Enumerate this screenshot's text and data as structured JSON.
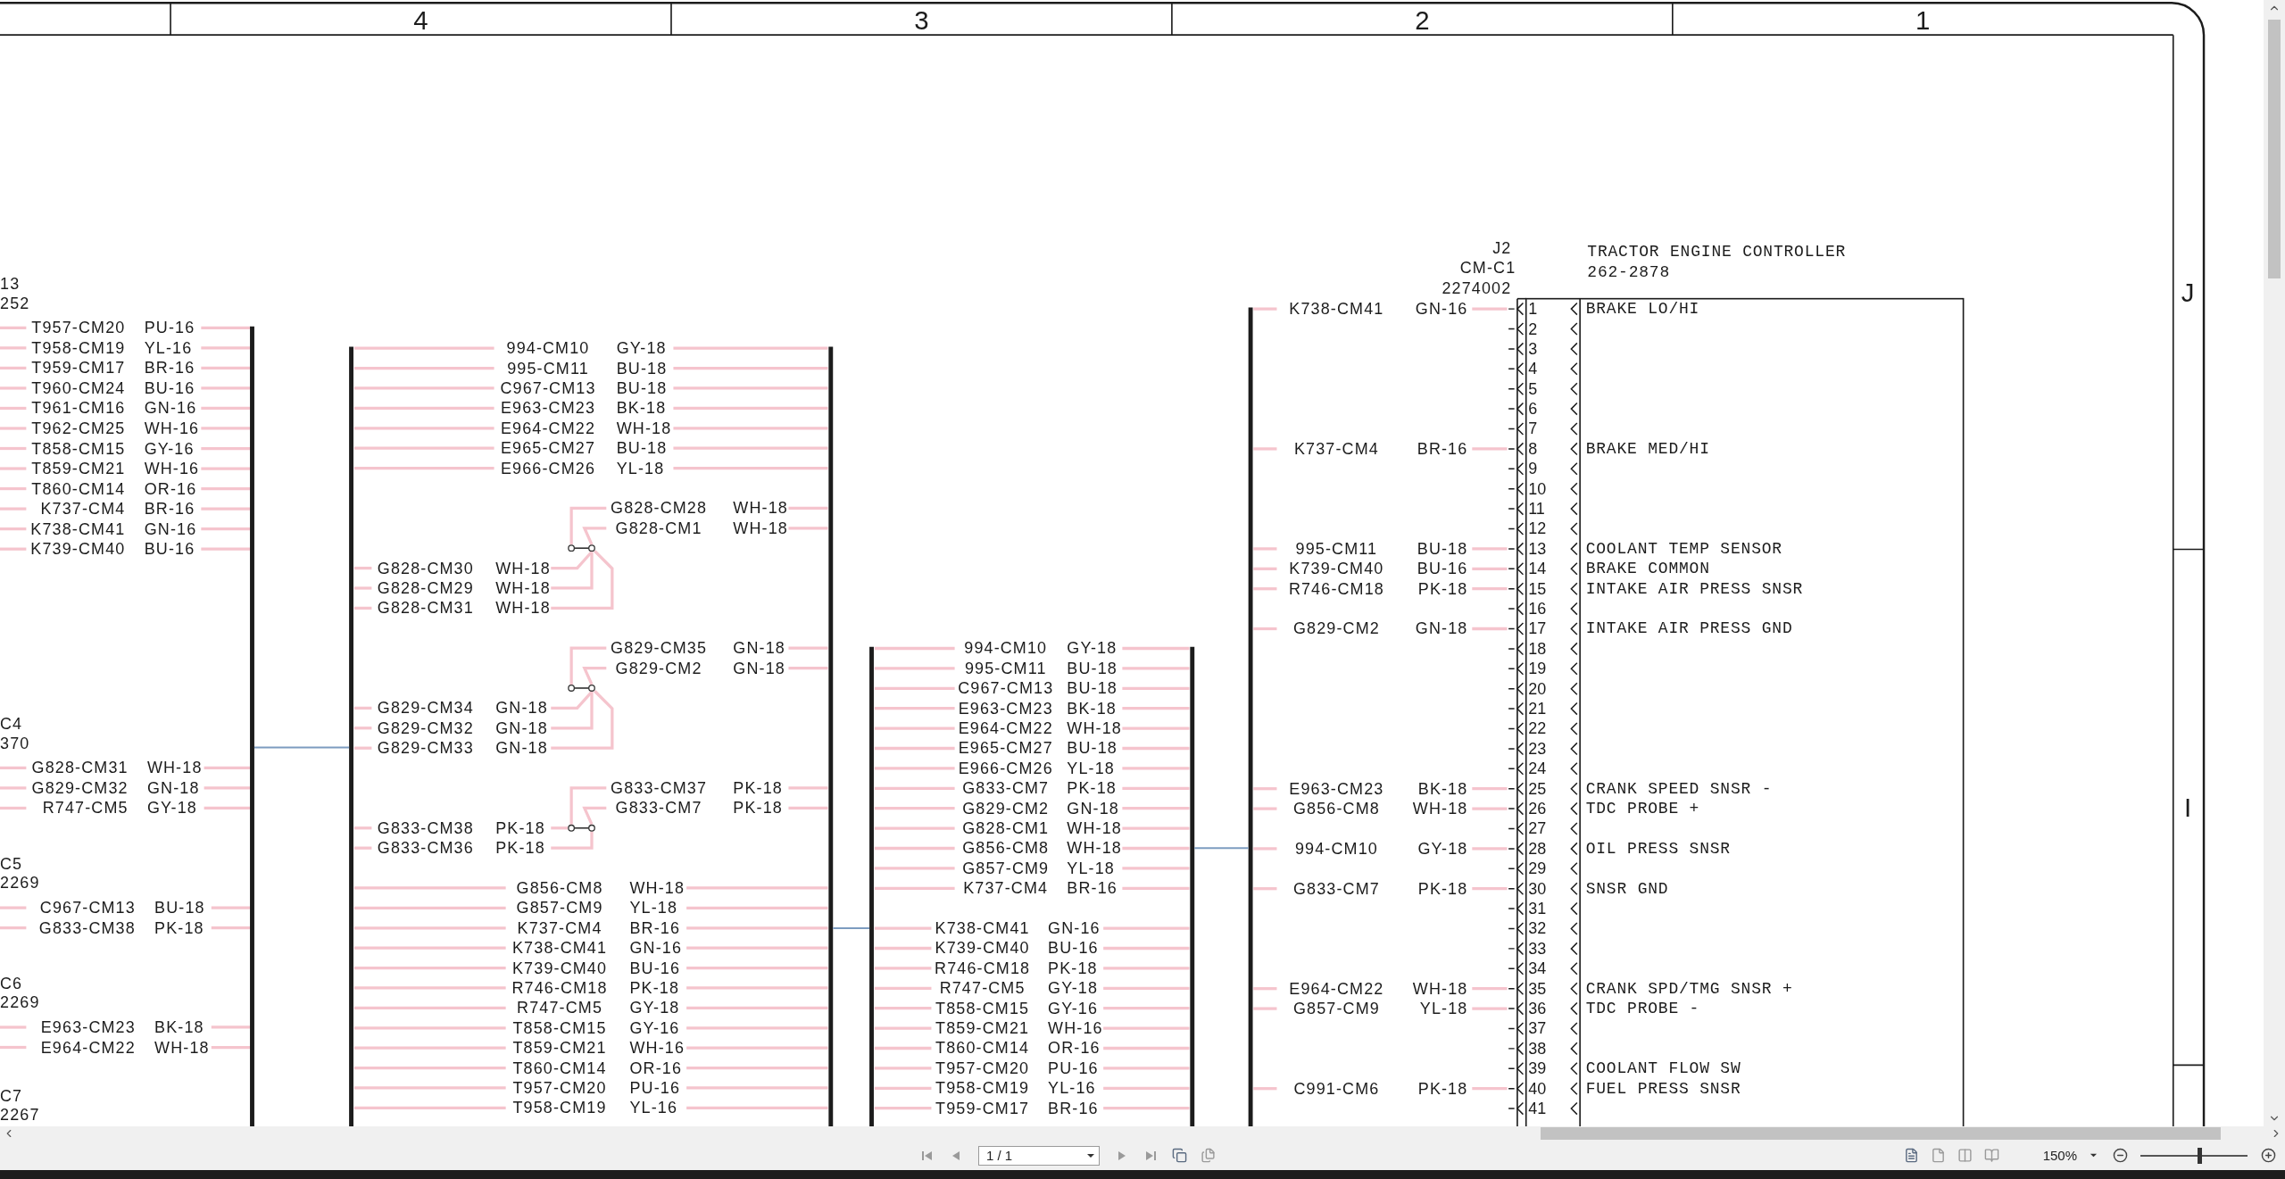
{
  "frame": {
    "columns": [
      "4",
      "3",
      "2",
      "1"
    ],
    "rows": [
      "J",
      "I"
    ]
  },
  "left_connectors": [
    {
      "name": "13",
      "part": "252",
      "wires": [
        {
          "circuit": "T957-CM20",
          "gauge": "PU-16"
        },
        {
          "circuit": "T958-CM19",
          "gauge": "YL-16"
        },
        {
          "circuit": "T959-CM17",
          "gauge": "BR-16"
        },
        {
          "circuit": "T960-CM24",
          "gauge": "BU-16"
        },
        {
          "circuit": "T961-CM16",
          "gauge": "GN-16"
        },
        {
          "circuit": "T962-CM25",
          "gauge": "WH-16"
        },
        {
          "circuit": "T858-CM15",
          "gauge": "GY-16"
        },
        {
          "circuit": "T859-CM21",
          "gauge": "WH-16"
        },
        {
          "circuit": "T860-CM14",
          "gauge": "OR-16"
        },
        {
          "circuit": "K737-CM4",
          "gauge": "BR-16"
        },
        {
          "circuit": "K738-CM41",
          "gauge": "GN-16"
        },
        {
          "circuit": "K739-CM40",
          "gauge": "BU-16"
        }
      ]
    },
    {
      "name": "C4",
      "part": "370",
      "wires": [
        {
          "circuit": "G828-CM31",
          "gauge": "WH-18"
        },
        {
          "circuit": "G829-CM32",
          "gauge": "GN-18"
        },
        {
          "circuit": "R747-CM5",
          "gauge": "GY-18"
        }
      ]
    },
    {
      "name": "C5",
      "part": "2269",
      "wires": [
        {
          "circuit": "C967-CM13",
          "gauge": "BU-18"
        },
        {
          "circuit": "G833-CM38",
          "gauge": "PK-18"
        }
      ]
    },
    {
      "name": "C6",
      "part": "2269",
      "wires": [
        {
          "circuit": "E963-CM23",
          "gauge": "BK-18"
        },
        {
          "circuit": "E964-CM22",
          "gauge": "WH-18"
        }
      ]
    },
    {
      "name": "C7",
      "part": "2267"
    }
  ],
  "splice_bus": {
    "sections": [
      {
        "kind": "through",
        "wires": [
          {
            "circuit": "994-CM10",
            "gauge": "GY-18"
          },
          {
            "circuit": "995-CM11",
            "gauge": "BU-18"
          },
          {
            "circuit": "C967-CM13",
            "gauge": "BU-18"
          },
          {
            "circuit": "E963-CM23",
            "gauge": "BK-18"
          },
          {
            "circuit": "E964-CM22",
            "gauge": "WH-18"
          },
          {
            "circuit": "E965-CM27",
            "gauge": "BU-18"
          },
          {
            "circuit": "E966-CM26",
            "gauge": "YL-18"
          }
        ]
      },
      {
        "kind": "splice",
        "right_wires": [
          {
            "circuit": "G828-CM28",
            "gauge": "WH-18"
          },
          {
            "circuit": "G828-CM1",
            "gauge": "WH-18"
          }
        ],
        "left_wires": [
          {
            "circuit": "G828-CM30",
            "gauge": "WH-18"
          },
          {
            "circuit": "G828-CM29",
            "gauge": "WH-18"
          },
          {
            "circuit": "G828-CM31",
            "gauge": "WH-18"
          }
        ]
      },
      {
        "kind": "splice",
        "right_wires": [
          {
            "circuit": "G829-CM35",
            "gauge": "GN-18"
          },
          {
            "circuit": "G829-CM2",
            "gauge": "GN-18"
          }
        ],
        "left_wires": [
          {
            "circuit": "G829-CM34",
            "gauge": "GN-18"
          },
          {
            "circuit": "G829-CM32",
            "gauge": "GN-18"
          },
          {
            "circuit": "G829-CM33",
            "gauge": "GN-18"
          }
        ]
      },
      {
        "kind": "splice",
        "right_wires": [
          {
            "circuit": "G833-CM37",
            "gauge": "PK-18"
          },
          {
            "circuit": "G833-CM7",
            "gauge": "PK-18"
          }
        ],
        "left_wires": [
          {
            "circuit": "G833-CM38",
            "gauge": "PK-18"
          },
          {
            "circuit": "G833-CM36",
            "gauge": "PK-18"
          }
        ]
      },
      {
        "kind": "through",
        "wires": [
          {
            "circuit": "G856-CM8",
            "gauge": "WH-18"
          },
          {
            "circuit": "G857-CM9",
            "gauge": "YL-18"
          },
          {
            "circuit": "K737-CM4",
            "gauge": "BR-16"
          },
          {
            "circuit": "K738-CM41",
            "gauge": "GN-16"
          },
          {
            "circuit": "K739-CM40",
            "gauge": "BU-16"
          },
          {
            "circuit": "R746-CM18",
            "gauge": "PK-18"
          },
          {
            "circuit": "R747-CM5",
            "gauge": "GY-18"
          },
          {
            "circuit": "T858-CM15",
            "gauge": "GY-16"
          },
          {
            "circuit": "T859-CM21",
            "gauge": "WH-16"
          },
          {
            "circuit": "T860-CM14",
            "gauge": "OR-16"
          },
          {
            "circuit": "T957-CM20",
            "gauge": "PU-16"
          },
          {
            "circuit": "T958-CM19",
            "gauge": "YL-16"
          }
        ]
      }
    ]
  },
  "harness_bus": {
    "sections": [
      {
        "kind": "through",
        "wires": [
          {
            "circuit": "994-CM10",
            "gauge": "GY-18"
          },
          {
            "circuit": "995-CM11",
            "gauge": "BU-18"
          },
          {
            "circuit": "C967-CM13",
            "gauge": "BU-18"
          },
          {
            "circuit": "E963-CM23",
            "gauge": "BK-18"
          },
          {
            "circuit": "E964-CM22",
            "gauge": "WH-18"
          },
          {
            "circuit": "E965-CM27",
            "gauge": "BU-18"
          },
          {
            "circuit": "E966-CM26",
            "gauge": "YL-18"
          },
          {
            "circuit": "G833-CM7",
            "gauge": "PK-18"
          },
          {
            "circuit": "G829-CM2",
            "gauge": "GN-18"
          },
          {
            "circuit": "G828-CM1",
            "gauge": "WH-18"
          },
          {
            "circuit": "G856-CM8",
            "gauge": "WH-18"
          },
          {
            "circuit": "G857-CM9",
            "gauge": "YL-18"
          },
          {
            "circuit": "K737-CM4",
            "gauge": "BR-16"
          }
        ]
      },
      {
        "kind": "through",
        "wires": [
          {
            "circuit": "K738-CM41",
            "gauge": "GN-16"
          },
          {
            "circuit": "K739-CM40",
            "gauge": "BU-16"
          },
          {
            "circuit": "R746-CM18",
            "gauge": "PK-18"
          },
          {
            "circuit": "R747-CM5",
            "gauge": "GY-18"
          },
          {
            "circuit": "T858-CM15",
            "gauge": "GY-16"
          },
          {
            "circuit": "T859-CM21",
            "gauge": "WH-16"
          },
          {
            "circuit": "T860-CM14",
            "gauge": "OR-16"
          },
          {
            "circuit": "T957-CM20",
            "gauge": "PU-16"
          },
          {
            "circuit": "T958-CM19",
            "gauge": "YL-16"
          },
          {
            "circuit": "T959-CM17",
            "gauge": "BR-16"
          }
        ]
      }
    ]
  },
  "controller": {
    "title": "TRACTOR ENGINE CONTROLLER",
    "part": "262-2878",
    "connector": {
      "name": "J2",
      "code": "CM-C1",
      "part": "2274002"
    },
    "pins": [
      {
        "number": "1",
        "function": "BRAKE LO/HI",
        "wire": {
          "circuit": "K738-CM41",
          "gauge": "GN-16"
        }
      },
      {
        "number": "2"
      },
      {
        "number": "3"
      },
      {
        "number": "4"
      },
      {
        "number": "5"
      },
      {
        "number": "6"
      },
      {
        "number": "7"
      },
      {
        "number": "8",
        "function": "BRAKE MED/HI",
        "wire": {
          "circuit": "K737-CM4",
          "gauge": "BR-16"
        }
      },
      {
        "number": "9"
      },
      {
        "number": "10"
      },
      {
        "number": "11"
      },
      {
        "number": "12"
      },
      {
        "number": "13",
        "function": "COOLANT TEMP SENSOR",
        "wire": {
          "circuit": "995-CM11",
          "gauge": "BU-18"
        }
      },
      {
        "number": "14",
        "function": "BRAKE COMMON",
        "wire": {
          "circuit": "K739-CM40",
          "gauge": "BU-16"
        }
      },
      {
        "number": "15",
        "function": "INTAKE AIR PRESS SNSR",
        "wire": {
          "circuit": "R746-CM18",
          "gauge": "PK-18"
        }
      },
      {
        "number": "16"
      },
      {
        "number": "17",
        "function": "INTAKE AIR PRESS GND",
        "wire": {
          "circuit": "G829-CM2",
          "gauge": "GN-18"
        }
      },
      {
        "number": "18"
      },
      {
        "number": "19"
      },
      {
        "number": "20"
      },
      {
        "number": "21"
      },
      {
        "number": "22"
      },
      {
        "number": "23"
      },
      {
        "number": "24"
      },
      {
        "number": "25",
        "function": "CRANK SPEED SNSR -",
        "wire": {
          "circuit": "E963-CM23",
          "gauge": "BK-18"
        }
      },
      {
        "number": "26",
        "function": "TDC PROBE +",
        "wire": {
          "circuit": "G856-CM8",
          "gauge": "WH-18"
        }
      },
      {
        "number": "27"
      },
      {
        "number": "28",
        "function": "OIL PRESS SNSR",
        "wire": {
          "circuit": "994-CM10",
          "gauge": "GY-18"
        }
      },
      {
        "number": "29"
      },
      {
        "number": "30",
        "function": "SNSR GND",
        "wire": {
          "circuit": "G833-CM7",
          "gauge": "PK-18"
        }
      },
      {
        "number": "31"
      },
      {
        "number": "32"
      },
      {
        "number": "33"
      },
      {
        "number": "34"
      },
      {
        "number": "35",
        "function": "CRANK SPD/TMG SNSR +",
        "wire": {
          "circuit": "E964-CM22",
          "gauge": "WH-18"
        }
      },
      {
        "number": "36",
        "function": "TDC PROBE -",
        "wire": {
          "circuit": "G857-CM9",
          "gauge": "YL-18"
        }
      },
      {
        "number": "37"
      },
      {
        "number": "38"
      },
      {
        "number": "39",
        "function": "COOLANT FLOW SW"
      },
      {
        "number": "40",
        "function": "FUEL PRESS SNSR",
        "wire": {
          "circuit": "C991-CM6",
          "gauge": "PK-18"
        }
      },
      {
        "number": "41"
      }
    ]
  },
  "viewer": {
    "page": "1 / 1",
    "zoom": "150%",
    "zoom_slider": {
      "level": 0.55
    }
  }
}
